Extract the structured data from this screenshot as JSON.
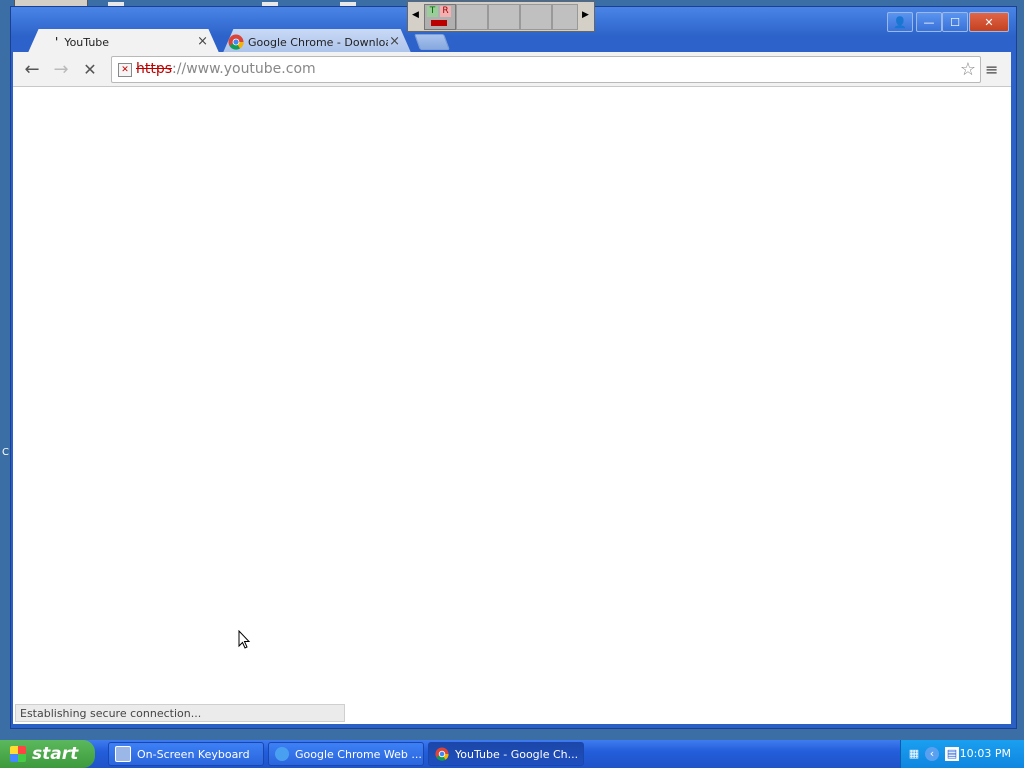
{
  "browser": {
    "tabs": [
      {
        "title": "YouTube",
        "close": "×"
      },
      {
        "title": "Google Chrome - Download f",
        "close": "×"
      }
    ],
    "url": {
      "scheme": "https",
      "rest": "://www.youtube.com"
    },
    "status": "Establishing secure connection..."
  },
  "mini_toolbar": {
    "t": "T",
    "r": "R"
  },
  "taskbar": {
    "start": "start",
    "items": [
      "On-Screen Keyboard",
      "Google Chrome Web ...",
      "YouTube - Google Ch..."
    ],
    "clock": "10:03 PM"
  },
  "icons": {
    "back": "←",
    "forward": "→",
    "stop": "✕",
    "star": "☆",
    "menu": "≡",
    "user": "👤",
    "minimize": "—",
    "maximize": "☐",
    "close": "✕"
  },
  "edge_letter": "C",
  "colors": {
    "desktop": "#3a6ea5",
    "taskbar": "#245edb",
    "start": "#3c9a3c"
  }
}
